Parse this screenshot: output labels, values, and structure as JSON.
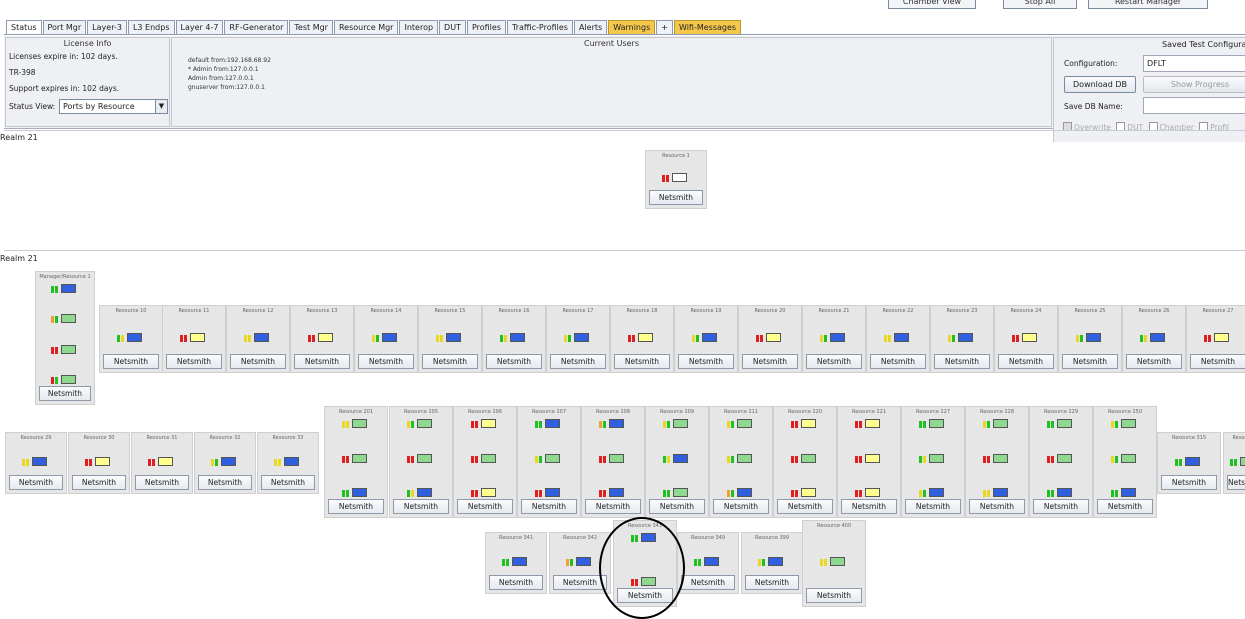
{
  "top_buttons": [
    "Chamber View",
    "Stop All",
    "Restart Manager"
  ],
  "tabs": [
    {
      "label": "Status",
      "style": "active"
    },
    {
      "label": "Port Mgr",
      "style": ""
    },
    {
      "label": "Layer-3",
      "style": ""
    },
    {
      "label": "L3 Endps",
      "style": ""
    },
    {
      "label": "Layer 4-7",
      "style": ""
    },
    {
      "label": "RF-Generator",
      "style": ""
    },
    {
      "label": "Test Mgr",
      "style": ""
    },
    {
      "label": "Resource Mgr",
      "style": ""
    },
    {
      "label": "Interop",
      "style": ""
    },
    {
      "label": "DUT",
      "style": ""
    },
    {
      "label": "Profiles",
      "style": ""
    },
    {
      "label": "Traffic-Profiles",
      "style": ""
    },
    {
      "label": "Alerts",
      "style": ""
    },
    {
      "label": "Warnings",
      "style": "warn"
    },
    {
      "label": "+",
      "style": ""
    },
    {
      "label": "Wifi-Messages",
      "style": "warn"
    }
  ],
  "license": {
    "title": "License Info",
    "expires": "Licenses expire in: 102 days.",
    "product": "TR-398",
    "support": "Support expires in: 102 days.",
    "status_view_label": "Status View:",
    "status_view_value": "Ports by Resource"
  },
  "users": {
    "title": "Current Users",
    "lines": [
      "default from:192.168.68.92",
      "* Admin from:127.0.0.1",
      "Admin from:127.0.0.1",
      "gnuserver from:127.0.0.1"
    ]
  },
  "saved": {
    "title": "Saved Test Configuration",
    "config_label": "Configuration:",
    "config_value": "DFLT",
    "download_label": "Download DB",
    "show_progress_label": "Show Progress",
    "save_name_label": "Save DB Name:",
    "save_name_value": "",
    "checks": [
      {
        "label": "Overwrite",
        "checked": true
      },
      {
        "label": "DUT",
        "checked": false
      },
      {
        "label": "Chamber",
        "checked": false
      },
      {
        "label": "Profil",
        "checked": false
      }
    ]
  },
  "realms": [
    "Realm 21",
    "Realm 21"
  ],
  "button_label": "Netsmith",
  "colors": {
    "red": "#e02020",
    "green": "#20c020",
    "yellow": "#e8d820",
    "orange": "#f0a030",
    "blue": "#3060e0",
    "lightgreen": "#8fd88f",
    "paleyellow": "#ffff90"
  },
  "resources": [
    {
      "name": "Resource 1",
      "rows": [
        [
          "red",
          "red",
          "white"
        ]
      ]
    },
    {
      "name": "Manager/Resource 1",
      "rows": [
        [
          "green",
          "green",
          "blue"
        ],
        [
          "orange",
          "green",
          "lightgreen"
        ],
        [
          "red",
          "red",
          "lightgreen"
        ],
        [
          "red",
          "green",
          "lightgreen"
        ]
      ]
    },
    {
      "name": "Resource 10",
      "rows": [
        [
          "green",
          "yellow",
          "blue"
        ]
      ]
    },
    {
      "name": "Resource 11",
      "rows": [
        [
          "red",
          "red",
          "paleyellow"
        ]
      ]
    },
    {
      "name": "Resource 12",
      "rows": [
        [
          "yellow",
          "yellow",
          "blue"
        ]
      ]
    },
    {
      "name": "Resource 13",
      "rows": [
        [
          "red",
          "red",
          "paleyellow"
        ]
      ]
    },
    {
      "name": "Resource 14",
      "rows": [
        [
          "yellow",
          "green",
          "blue"
        ]
      ]
    },
    {
      "name": "Resource 15",
      "rows": [
        [
          "yellow",
          "yellow",
          "blue"
        ]
      ]
    },
    {
      "name": "Resource 16",
      "rows": [
        [
          "green",
          "yellow",
          "blue"
        ]
      ]
    },
    {
      "name": "Resource 17",
      "rows": [
        [
          "yellow",
          "green",
          "blue"
        ]
      ]
    },
    {
      "name": "Resource 18",
      "rows": [
        [
          "red",
          "red",
          "paleyellow"
        ]
      ]
    },
    {
      "name": "Resource 19",
      "rows": [
        [
          "yellow",
          "green",
          "blue"
        ]
      ]
    },
    {
      "name": "Resource 20",
      "rows": [
        [
          "red",
          "red",
          "paleyellow"
        ]
      ]
    },
    {
      "name": "Resource 21",
      "rows": [
        [
          "yellow",
          "green",
          "blue"
        ]
      ]
    },
    {
      "name": "Resource 22",
      "rows": [
        [
          "yellow",
          "yellow",
          "blue"
        ]
      ]
    },
    {
      "name": "Resource 23",
      "rows": [
        [
          "yellow",
          "green",
          "blue"
        ]
      ]
    },
    {
      "name": "Resource 24",
      "rows": [
        [
          "red",
          "red",
          "paleyellow"
        ]
      ]
    },
    {
      "name": "Resource 25",
      "rows": [
        [
          "yellow",
          "green",
          "blue"
        ]
      ]
    },
    {
      "name": "Resource 26",
      "rows": [
        [
          "green",
          "yellow",
          "blue"
        ]
      ]
    },
    {
      "name": "Resource 27",
      "rows": [
        [
          "red",
          "red",
          "paleyellow"
        ]
      ]
    },
    {
      "name": "Resource 29",
      "rows": [
        [
          "yellow",
          "yellow",
          "blue"
        ]
      ]
    },
    {
      "name": "Resource 30",
      "rows": [
        [
          "red",
          "red",
          "paleyellow"
        ]
      ]
    },
    {
      "name": "Resource 31",
      "rows": [
        [
          "red",
          "red",
          "paleyellow"
        ]
      ]
    },
    {
      "name": "Resource 32",
      "rows": [
        [
          "yellow",
          "green",
          "blue"
        ]
      ]
    },
    {
      "name": "Resource 33",
      "rows": [
        [
          "yellow",
          "yellow",
          "blue"
        ]
      ]
    },
    {
      "name": "Resource 201",
      "rows": [
        [
          "yellow",
          "yellow",
          "lightgreen"
        ],
        [
          "red",
          "red",
          "lightgreen"
        ],
        [
          "green",
          "green",
          "blue"
        ]
      ]
    },
    {
      "name": "Resource 205",
      "rows": [
        [
          "yellow",
          "green",
          "lightgreen"
        ],
        [
          "red",
          "red",
          "lightgreen"
        ],
        [
          "green",
          "yellow",
          "blue"
        ]
      ]
    },
    {
      "name": "Resource 206",
      "rows": [
        [
          "red",
          "red",
          "paleyellow"
        ],
        [
          "red",
          "red",
          "lightgreen"
        ],
        [
          "red",
          "red",
          "paleyellow"
        ]
      ]
    },
    {
      "name": "Resource 207",
      "rows": [
        [
          "green",
          "green",
          "blue"
        ],
        [
          "yellow",
          "green",
          "lightgreen"
        ],
        [
          "red",
          "red",
          "blue"
        ]
      ]
    },
    {
      "name": "Resource 208",
      "rows": [
        [
          "orange",
          "green",
          "blue"
        ],
        [
          "red",
          "red",
          "lightgreen"
        ],
        [
          "red",
          "red",
          "blue"
        ]
      ]
    },
    {
      "name": "Resource 209",
      "rows": [
        [
          "yellow",
          "green",
          "lightgreen"
        ],
        [
          "green",
          "yellow",
          "blue"
        ],
        [
          "green",
          "green",
          "lightgreen"
        ]
      ]
    },
    {
      "name": "Resource 211",
      "rows": [
        [
          "yellow",
          "green",
          "lightgreen"
        ],
        [
          "yellow",
          "green",
          "lightgreen"
        ],
        [
          "orange",
          "green",
          "blue"
        ]
      ]
    },
    {
      "name": "Resource 220",
      "rows": [
        [
          "red",
          "red",
          "paleyellow"
        ],
        [
          "red",
          "red",
          "lightgreen"
        ],
        [
          "red",
          "red",
          "paleyellow"
        ]
      ]
    },
    {
      "name": "Resource 221",
      "rows": [
        [
          "red",
          "red",
          "paleyellow"
        ],
        [
          "red",
          "red",
          "paleyellow"
        ],
        [
          "red",
          "red",
          "paleyellow"
        ]
      ]
    },
    {
      "name": "Resource 227",
      "rows": [
        [
          "green",
          "green",
          "lightgreen"
        ],
        [
          "green",
          "yellow",
          "lightgreen"
        ],
        [
          "yellow",
          "green",
          "blue"
        ]
      ]
    },
    {
      "name": "Resource 228",
      "rows": [
        [
          "yellow",
          "green",
          "lightgreen"
        ],
        [
          "red",
          "red",
          "lightgreen"
        ],
        [
          "yellow",
          "yellow",
          "blue"
        ]
      ]
    },
    {
      "name": "Resource 229",
      "rows": [
        [
          "green",
          "green",
          "lightgreen"
        ],
        [
          "red",
          "red",
          "lightgreen"
        ],
        [
          "green",
          "green",
          "blue"
        ]
      ]
    },
    {
      "name": "Resource 250",
      "rows": [
        [
          "yellow",
          "green",
          "lightgreen"
        ],
        [
          "yellow",
          "green",
          "lightgreen"
        ],
        [
          "green",
          "green",
          "blue"
        ]
      ]
    },
    {
      "name": "Resource 315",
      "rows": [
        [
          "green",
          "green",
          "blue"
        ]
      ]
    },
    {
      "name": "Resource",
      "rows": [
        [
          "green",
          "green",
          "lightgreen"
        ]
      ]
    },
    {
      "name": "Resource 341",
      "rows": [
        [
          "green",
          "green",
          "blue"
        ]
      ]
    },
    {
      "name": "Resource 342",
      "rows": [
        [
          "orange",
          "green",
          "blue"
        ]
      ]
    },
    {
      "name": "Resource 343",
      "rows": [
        [
          "green",
          "green",
          "blue"
        ],
        [
          "red",
          "red",
          "lightgreen"
        ]
      ]
    },
    {
      "name": "Resource 349",
      "rows": [
        [
          "green",
          "green",
          "blue"
        ]
      ]
    },
    {
      "name": "Resource 399",
      "rows": [
        [
          "yellow",
          "green",
          "blue"
        ]
      ]
    },
    {
      "name": "Resource 400",
      "rows": [
        [
          "yellow",
          "yellow",
          "lightgreen"
        ]
      ]
    }
  ]
}
